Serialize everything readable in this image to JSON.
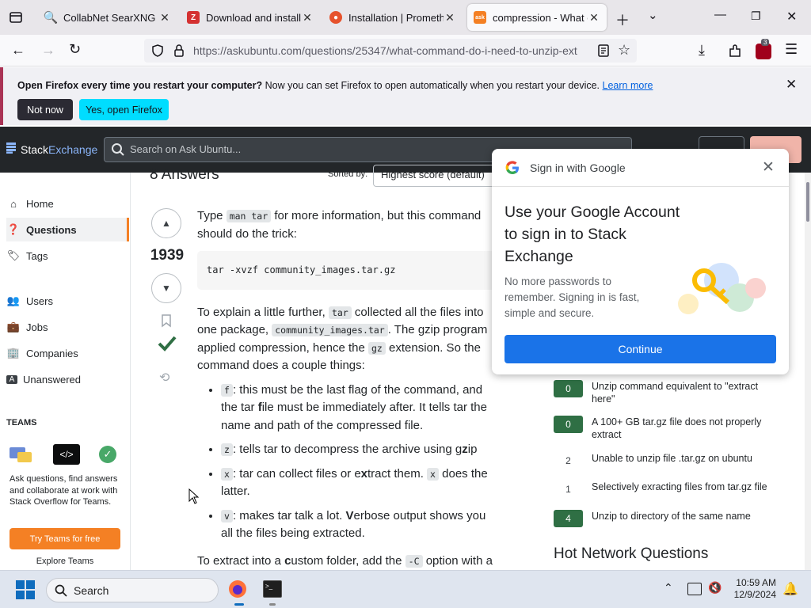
{
  "tabs": [
    {
      "title": "CollabNet SearXNG",
      "favicon_color": "#3050c8",
      "favicon_glyph": "Q"
    },
    {
      "title": "Download and install Z",
      "favicon_color": "#d43131",
      "favicon_glyph": "Z"
    },
    {
      "title": "Installation | Promethe",
      "favicon_color": "#e6522c",
      "favicon_glyph": "●"
    },
    {
      "title": "compression - What co",
      "favicon_color": "#f48024",
      "favicon_glyph": "ask"
    }
  ],
  "address": {
    "url": "https://askubuntu.com/questions/25347/what-command-do-i-need-to-unzip-ext"
  },
  "toolbar": {
    "extensions_badge": "3"
  },
  "notification": {
    "bold": "Open Firefox every time you restart your computer?",
    "text": " Now you can set Firefox to open automatically when you restart your device. ",
    "link": "Learn more",
    "not_now": "Not now",
    "yes_open": "Yes, open Firefox"
  },
  "site": {
    "logo_a": "Stack",
    "logo_b": "Exchange",
    "search_placeholder": "Search on Ask Ubuntu..."
  },
  "leftnav": {
    "items": [
      "Home",
      "Questions",
      "Tags",
      "Users",
      "Jobs",
      "Companies",
      "Unanswered"
    ],
    "teams_heading": "TEAMS",
    "teams_text": "Ask questions, find answers and collaborate at work with Stack Overflow for Teams.",
    "try_button": "Try Teams for free",
    "explore": "Explore Teams"
  },
  "main": {
    "answers_header": "8 Answers",
    "sort_label": "Sorted by:",
    "sort_value": "Highest score (default)",
    "vote_count": "1939",
    "p1_a": "Type ",
    "p1_code": "man tar",
    "p1_b": " for more information, but this command should do the trick:",
    "pre": "tar -xvzf community_images.tar.gz",
    "p2_a": "To explain a little further, ",
    "p2_code1": "tar",
    "p2_b": " collected all the files into one package, ",
    "p2_code2": "community_images.tar",
    "p2_c": ". The gzip program applied compression, hence the ",
    "p2_code3": "gz",
    "p2_d": " extension. So the command does a couple things:",
    "li1_code": "f",
    "li1_a": ": this must be the last flag of the command, and the tar ",
    "li1_bold": "f",
    "li1_b": "ile must be immediately after. It tells tar the name and path of the compressed file.",
    "li2_code": "z",
    "li2_a": ": tells tar to decompress the archive using g",
    "li2_bold": "z",
    "li2_b": "ip",
    "li3_code": "x",
    "li3_a": ": tar can collect files or e",
    "li3_bold": "x",
    "li3_b": "tract them. ",
    "li3_code2": "x",
    "li3_c": " does the latter.",
    "li4_code": "v",
    "li4_a": ": makes tar talk a lot. ",
    "li4_bold": "V",
    "li4_b": "erbose output shows you all the files being extracted.",
    "p3_a": "To extract into a ",
    "p3_bold": "c",
    "p3_b": "ustom folder, add the ",
    "p3_code": "-C",
    "p3_c": " option with a"
  },
  "related": [
    {
      "count": "0",
      "accepted": true,
      "title": "Unzip command equivalent to \"extract here\""
    },
    {
      "count": "0",
      "accepted": true,
      "title": "A 100+ GB tar.gz file does not properly extract"
    },
    {
      "count": "2",
      "accepted": false,
      "title": "Unable to unzip file .tar.gz on ubuntu"
    },
    {
      "count": "1",
      "accepted": false,
      "title": "Selectively exracting files from tar.gz file"
    },
    {
      "count": "4",
      "accepted": true,
      "title": "Unzip to directory of the same name"
    }
  ],
  "hot_network": "Hot Network Questions",
  "google_popup": {
    "header": "Sign in with Google",
    "headline": "Use your Google Account to sign in to Stack Exchange",
    "body": "No more passwords to remember. Signing in is fast, simple and secure.",
    "button": "Continue"
  },
  "taskbar": {
    "search": "Search",
    "time": "10:59 AM",
    "date": "12/9/2024"
  }
}
